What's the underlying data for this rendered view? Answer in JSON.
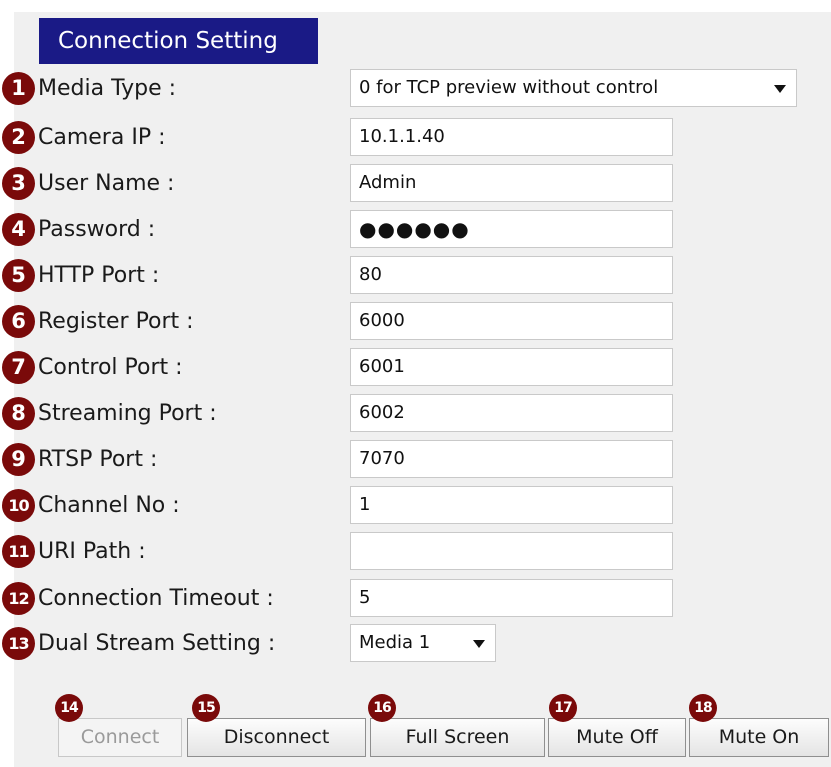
{
  "header": {
    "title": "Connection Setting"
  },
  "fields": [
    {
      "num": "1",
      "label": "Media Type :",
      "type": "select",
      "value": "0 for TCP preview without control"
    },
    {
      "num": "2",
      "label": "Camera IP :",
      "type": "text",
      "value": "10.1.1.40"
    },
    {
      "num": "3",
      "label": "User Name :",
      "type": "text",
      "value": "Admin"
    },
    {
      "num": "4",
      "label": "Password :",
      "type": "password",
      "value": "●●●●●●"
    },
    {
      "num": "5",
      "label": "HTTP Port :",
      "type": "text",
      "value": "80"
    },
    {
      "num": "6",
      "label": "Register Port :",
      "type": "text",
      "value": "6000"
    },
    {
      "num": "7",
      "label": "Control Port :",
      "type": "text",
      "value": "6001"
    },
    {
      "num": "8",
      "label": "Streaming Port :",
      "type": "text",
      "value": "6002"
    },
    {
      "num": "9",
      "label": "RTSP Port :",
      "type": "text",
      "value": "7070"
    },
    {
      "num": "10",
      "label": "Channel No :",
      "type": "text",
      "value": "1"
    },
    {
      "num": "11",
      "label": "URI Path :",
      "type": "text",
      "value": ""
    },
    {
      "num": "12",
      "label": "Connection Timeout :",
      "type": "text",
      "value": "5"
    },
    {
      "num": "13",
      "label": "Dual Stream Setting :",
      "type": "select",
      "value": "Media 1"
    }
  ],
  "buttons": [
    {
      "num": "14",
      "label": "Connect",
      "enabled": false
    },
    {
      "num": "15",
      "label": "Disconnect",
      "enabled": true
    },
    {
      "num": "16",
      "label": "Full Screen",
      "enabled": true
    },
    {
      "num": "17",
      "label": "Mute Off",
      "enabled": true
    },
    {
      "num": "18",
      "label": "Mute On",
      "enabled": true
    }
  ],
  "colors": {
    "header_bg": "#1a1a86",
    "badge": "#7a0a0a",
    "panel_bg": "#f0f0f0"
  }
}
